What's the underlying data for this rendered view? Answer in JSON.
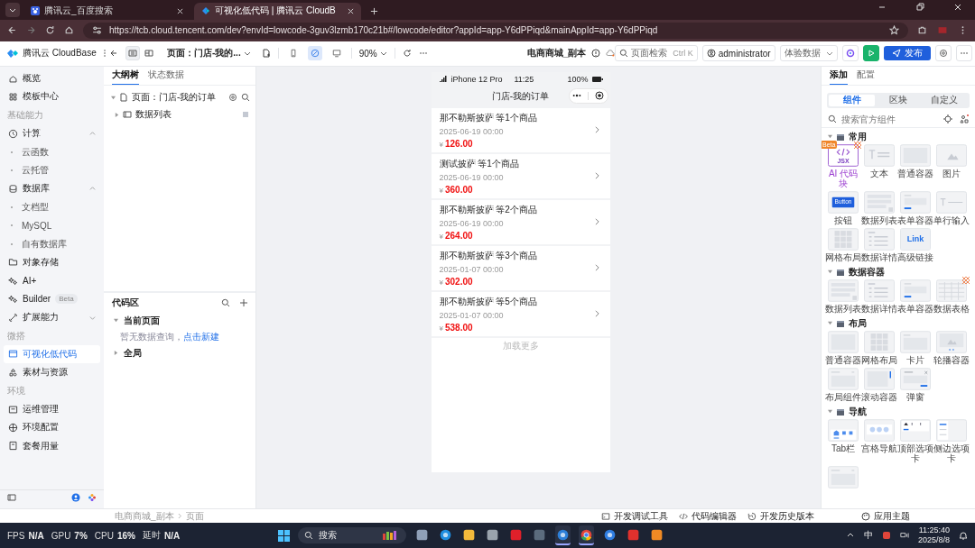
{
  "browser": {
    "tabs": [
      {
        "title": "腾讯云_百度搜索",
        "selected": false
      },
      {
        "title": "可视化低代码 | 腾讯云 CloudB",
        "selected": true
      }
    ],
    "url": "https://tcb.cloud.tencent.com/dev?envId=lowcode-3guv3lzmb170c21b#/lowcode/editor?appId=app-Y6dPPiqd&mainAppId=app-Y6dPPiqd"
  },
  "header": {
    "brand": "腾讯云 CloudBase",
    "views": [
      {
        "selected": true
      },
      {
        "selected": false
      }
    ],
    "page_select": "页面：门店-我的...",
    "devices": [
      {
        "kind": "phone",
        "selected": false
      },
      {
        "kind": "responsive",
        "selected": true
      },
      {
        "kind": "desktop",
        "selected": false
      }
    ],
    "zoom": "90%",
    "app_title": "电商商城_副本",
    "search": {
      "label": "页面检索",
      "shortcut": "Ctrl K"
    },
    "user": "administrator",
    "data_select": "体验数据",
    "publish": "发布"
  },
  "sidebar": {
    "items": [
      {
        "kind": "item",
        "label": "概览",
        "selected": false
      },
      {
        "kind": "item",
        "label": "模板中心",
        "selected": false
      },
      {
        "kind": "section",
        "label": "基础能力"
      },
      {
        "kind": "item",
        "label": "计算",
        "selected": false,
        "expanded": true
      },
      {
        "kind": "sub",
        "label": "云函数",
        "selected": false
      },
      {
        "kind": "sub",
        "label": "云托管",
        "selected": false
      },
      {
        "kind": "item",
        "label": "数据库",
        "selected": false,
        "expanded": true
      },
      {
        "kind": "sub",
        "label": "文档型",
        "selected": false
      },
      {
        "kind": "sub",
        "label": "MySQL",
        "selected": false
      },
      {
        "kind": "sub",
        "label": "自有数据库",
        "selected": false
      },
      {
        "kind": "item",
        "label": "对象存储",
        "selected": false
      },
      {
        "kind": "item",
        "label": "AI+",
        "selected": false
      },
      {
        "kind": "item",
        "label": "Builder",
        "badge": "Beta",
        "selected": false
      },
      {
        "kind": "item",
        "label": "扩展能力",
        "selected": false,
        "expanded": false
      },
      {
        "kind": "section",
        "label": "微搭"
      },
      {
        "kind": "item",
        "label": "可视化低代码",
        "selected": true
      },
      {
        "kind": "item",
        "label": "素材与资源",
        "selected": false
      },
      {
        "kind": "section",
        "label": "环境"
      },
      {
        "kind": "item",
        "label": "运维管理",
        "selected": false
      },
      {
        "kind": "item",
        "label": "环境配置",
        "selected": false
      },
      {
        "kind": "item",
        "label": "套餐用量",
        "selected": false
      }
    ]
  },
  "outline": {
    "tabs": [
      {
        "label": "大纲树",
        "selected": true
      },
      {
        "label": "状态数据",
        "selected": false
      }
    ],
    "tree": [
      {
        "label": "页面：门店-我的订单",
        "expanded": true,
        "children": [
          {
            "label": "数据列表",
            "expanded": false
          }
        ]
      }
    ]
  },
  "code_area": {
    "title": "代码区",
    "groups": [
      {
        "label": "当前页面",
        "expanded": true,
        "empty_text": "暂无数据查询，",
        "link": "点击新建"
      },
      {
        "label": "全局",
        "expanded": false
      }
    ]
  },
  "phone": {
    "device": "iPhone 12 Pro",
    "time": "11:25",
    "battery": "100%",
    "title": "门店-我的订单",
    "orders": [
      {
        "title": "那不勒斯披萨 等1个商品",
        "date": "2025-06-19 00:00",
        "currency": "¥",
        "amount": "126.00"
      },
      {
        "title": "测试披萨 等1个商品",
        "date": "2025-06-19 00:00",
        "currency": "¥",
        "amount": "360.00"
      },
      {
        "title": "那不勒斯披萨 等2个商品",
        "date": "2025-06-19 00:00",
        "currency": "¥",
        "amount": "264.00"
      },
      {
        "title": "那不勒斯披萨 等3个商品",
        "date": "2025-01-07 00:00",
        "currency": "¥",
        "amount": "302.00"
      },
      {
        "title": "那不勒斯披萨 等5个商品",
        "date": "2025-01-07 00:00",
        "currency": "¥",
        "amount": "538.00"
      }
    ],
    "load_more": "加载更多"
  },
  "components": {
    "tabs": [
      {
        "label": "添加",
        "selected": true
      },
      {
        "label": "配置",
        "selected": false
      }
    ],
    "segments": [
      {
        "label": "组件",
        "selected": true
      },
      {
        "label": "区块",
        "selected": false
      },
      {
        "label": "自定义",
        "selected": false
      }
    ],
    "search": {
      "placeholder": "搜索官方组件"
    },
    "groups": [
      {
        "title": "常用",
        "expanded": true,
        "items": [
          {
            "kind": "jsx",
            "label": "AI 代码块",
            "caption": "JSX",
            "badge": "Beta",
            "hot": true
          },
          {
            "kind": "text",
            "label": "文本"
          },
          {
            "kind": "container",
            "label": "普通容器"
          },
          {
            "kind": "image",
            "label": "图片"
          },
          {
            "kind": "button",
            "label": "按钮",
            "caption": "Button"
          },
          {
            "kind": "list",
            "label": "数据列表"
          },
          {
            "kind": "form",
            "label": "表单容器"
          },
          {
            "kind": "input",
            "label": "单行输入"
          },
          {
            "kind": "grid",
            "label": "网格布局"
          },
          {
            "kind": "detail",
            "label": "数据详情"
          },
          {
            "kind": "link",
            "label": "高级链接",
            "caption": "Link"
          }
        ]
      },
      {
        "title": "数据容器",
        "expanded": true,
        "items": [
          {
            "kind": "list",
            "label": "数据列表"
          },
          {
            "kind": "detail",
            "label": "数据详情"
          },
          {
            "kind": "form",
            "label": "表单容器"
          },
          {
            "kind": "table",
            "label": "数据表格",
            "hot": true
          }
        ]
      },
      {
        "title": "布局",
        "expanded": true,
        "items": [
          {
            "kind": "container",
            "label": "普通容器"
          },
          {
            "kind": "grid",
            "label": "网格布局"
          },
          {
            "kind": "card",
            "label": "卡片"
          },
          {
            "kind": "carousel",
            "label": "轮播容器"
          },
          {
            "kind": "layout",
            "label": "布局组件"
          },
          {
            "kind": "scroll",
            "label": "滚动容器"
          },
          {
            "kind": "modal",
            "label": "弹窗"
          }
        ]
      },
      {
        "title": "导航",
        "expanded": true,
        "items": [
          {
            "kind": "tabbar",
            "label": "Tab栏"
          },
          {
            "kind": "gridnav",
            "label": "宫格导航"
          },
          {
            "kind": "toptabs",
            "label": "顶部选项卡"
          },
          {
            "kind": "sidetabs",
            "label": "侧边选项卡"
          },
          {
            "kind": "layout"
          }
        ]
      }
    ]
  },
  "status_bar": {
    "breadcrumb": [
      "电商商城_副本",
      "页面"
    ],
    "actions": [
      {
        "kind": "debug",
        "label": "开发调试工具"
      },
      {
        "kind": "code",
        "label": "代码编辑器"
      },
      {
        "kind": "history",
        "label": "开发历史版本"
      }
    ],
    "theme": "应用主题"
  },
  "taskbar": {
    "stats": [
      {
        "label": "FPS",
        "value": "N/A"
      },
      {
        "label": "GPU",
        "value": "7%"
      },
      {
        "label": "CPU",
        "value": "16%"
      },
      {
        "label": "延时",
        "value": "N/A"
      }
    ],
    "search": "搜索",
    "apps": [
      {
        "kind": "files",
        "active": false
      },
      {
        "kind": "edge",
        "active": false
      },
      {
        "kind": "folder",
        "active": false
      },
      {
        "kind": "recorder",
        "active": false
      },
      {
        "kind": "red",
        "active": false
      },
      {
        "kind": "calculator",
        "active": false
      },
      {
        "kind": "q",
        "active": true
      },
      {
        "kind": "chrome",
        "active": true
      },
      {
        "kind": "s",
        "active": false
      },
      {
        "kind": "wps",
        "active": false
      },
      {
        "kind": "sublime",
        "active": false
      }
    ],
    "ime": "中",
    "time": "11:25:40",
    "date": "2025/8/8"
  }
}
